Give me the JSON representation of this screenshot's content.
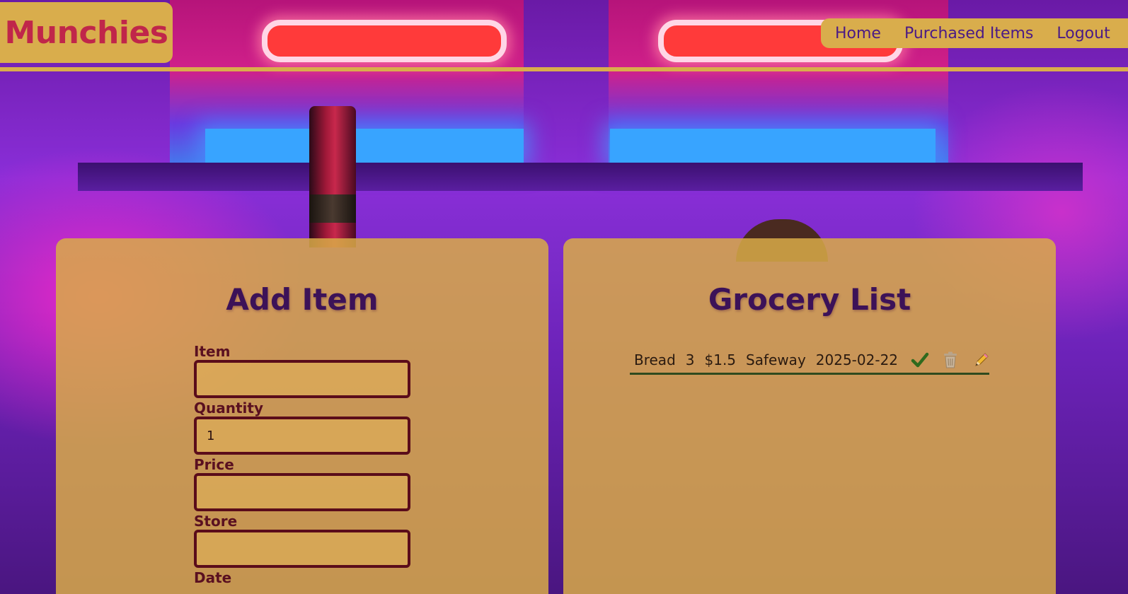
{
  "header": {
    "logo": "Munchies",
    "nav": {
      "home": "Home",
      "purchased": "Purchased Items",
      "logout": "Logout"
    }
  },
  "add_item": {
    "title": "Add Item",
    "fields": {
      "item": {
        "label": "Item",
        "value": ""
      },
      "quantity": {
        "label": "Quantity",
        "value": "1"
      },
      "price": {
        "label": "Price",
        "value": ""
      },
      "store": {
        "label": "Store",
        "value": ""
      },
      "date": {
        "label": "Date"
      }
    }
  },
  "grocery_list": {
    "title": "Grocery List",
    "items": [
      {
        "name": "Bread",
        "quantity": "3",
        "price": "$1.5",
        "store": "Safeway",
        "date": "2025-02-22"
      }
    ]
  },
  "icons": {
    "check": "check-icon",
    "trash": "trash-icon",
    "edit": "pencil-icon"
  },
  "colors": {
    "accent": "#d9ad4c",
    "logo_text": "#c0264a",
    "nav_text": "#4a1a86",
    "title_text": "#3c1258",
    "input_border": "#5a0c1a",
    "check": "#2f6a1e"
  }
}
